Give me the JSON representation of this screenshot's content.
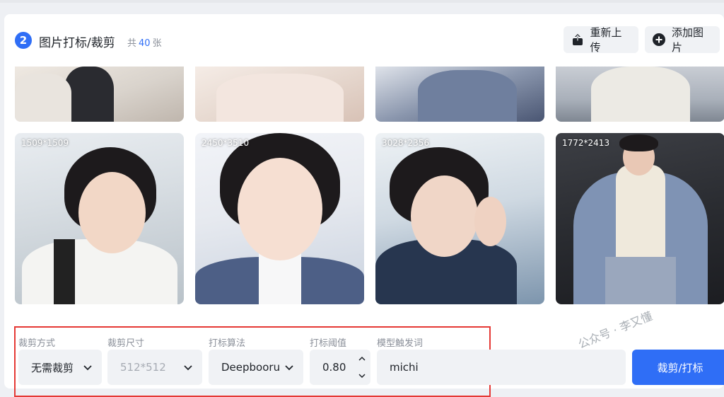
{
  "section": {
    "step": "2",
    "title": "图片打标/裁剪",
    "count_prefix": "共",
    "count_value": "40",
    "count_suffix": "张"
  },
  "header_buttons": {
    "reupload_label": "重新上传",
    "reupload_icon": "upload-icon",
    "add_label": "添加图片",
    "add_icon": "plus-circle-icon"
  },
  "images": [
    {
      "size": ""
    },
    {
      "size": ""
    },
    {
      "size": ""
    },
    {
      "size": ""
    },
    {
      "size": "1509*1509"
    },
    {
      "size": "2450*3510"
    },
    {
      "size": "3028*2356"
    },
    {
      "size": "1772*2413"
    }
  ],
  "controls": {
    "crop_mode": {
      "label": "裁剪方式",
      "value": "无需裁剪"
    },
    "crop_size": {
      "label": "裁剪尺寸",
      "value": "512*512"
    },
    "tag_algo": {
      "label": "打标算法",
      "value": "Deepbooru"
    },
    "threshold": {
      "label": "打标阈值",
      "value": "0.80"
    },
    "trigger": {
      "label": "模型触发词",
      "value": "michi"
    }
  },
  "action_button": "裁剪/打标",
  "watermark": "公众号 · 李又懂",
  "colors": {
    "accent": "#2f6ef6",
    "highlight": "#e53935"
  }
}
